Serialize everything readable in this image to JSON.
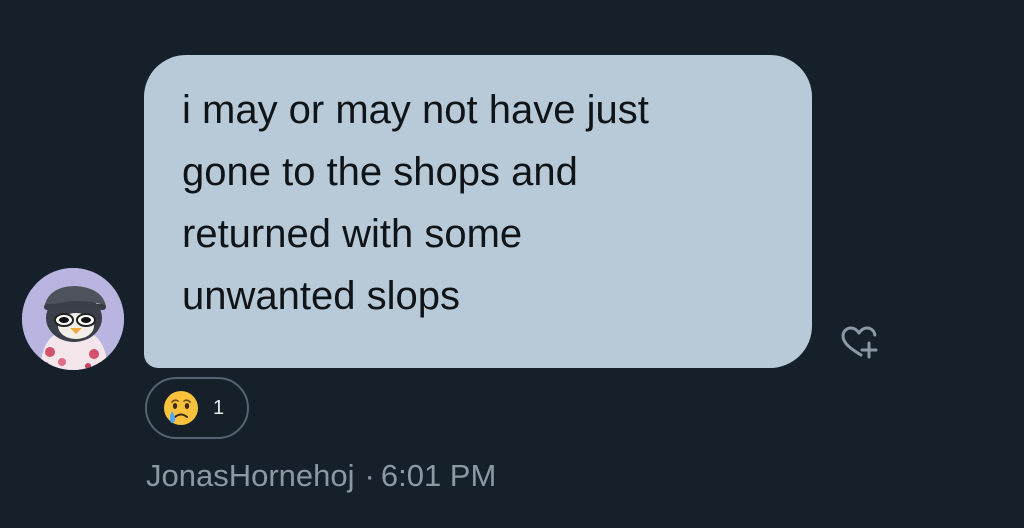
{
  "message": {
    "text": "i may or may not have just\ngone to the shops and\nreturned with some\nunwanted slops",
    "bubble_color": "#b8cad8",
    "text_color": "#0f1419"
  },
  "sender": {
    "username": "JonasHornehoj",
    "separator": "·",
    "time": "6:01 PM",
    "avatar_icon": "penguin-avatar-icon"
  },
  "reactions": [
    {
      "emoji": "crying-face-icon",
      "count": "1"
    }
  ],
  "actions": {
    "add_reaction_icon": "heart-plus-icon"
  },
  "theme": {
    "background": "#15202b",
    "muted_text": "#8b98a5",
    "pill_border": "#536471"
  }
}
